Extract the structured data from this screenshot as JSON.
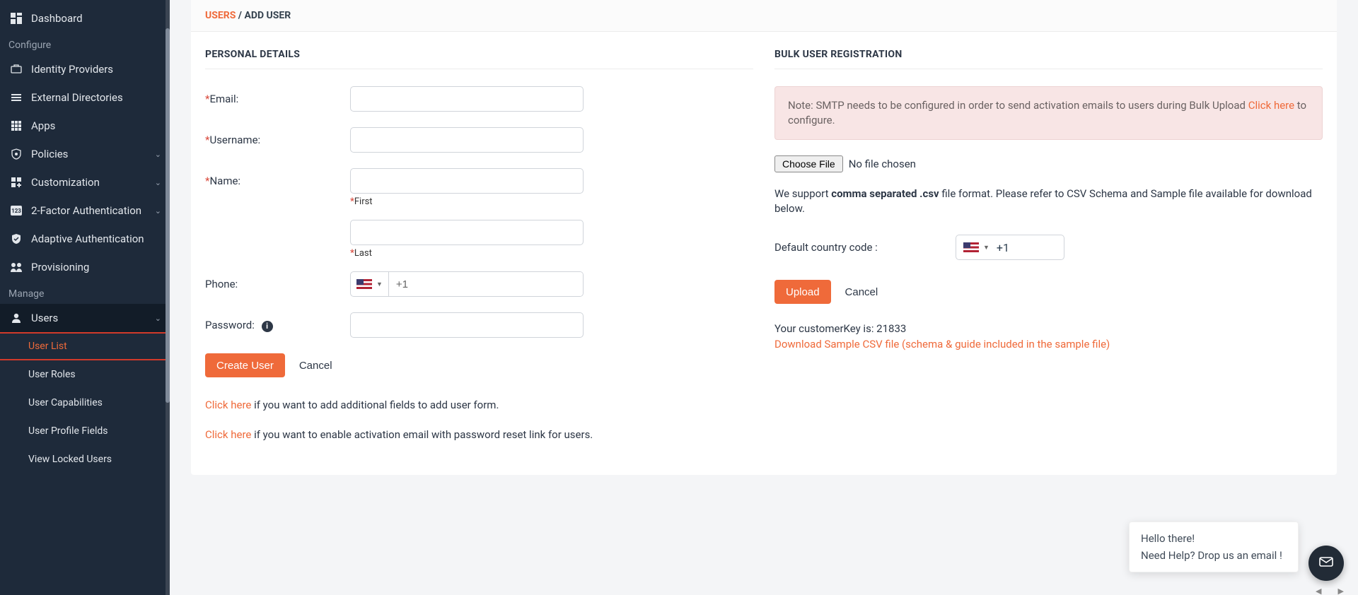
{
  "sidebar": {
    "items": [
      {
        "label": "Dashboard",
        "icon": "dashboard-icon"
      }
    ],
    "section_configure": "Configure",
    "configure_items": [
      {
        "label": "Identity Providers",
        "icon": "idp-icon",
        "chev": false
      },
      {
        "label": "External Directories",
        "icon": "ext-dir-icon",
        "chev": false
      },
      {
        "label": "Apps",
        "icon": "apps-icon",
        "chev": false
      },
      {
        "label": "Policies",
        "icon": "policies-icon",
        "chev": true
      },
      {
        "label": "Customization",
        "icon": "customize-icon",
        "chev": true
      },
      {
        "label": "2-Factor Authentication",
        "icon": "twofa-icon",
        "chev": true
      },
      {
        "label": "Adaptive Authentication",
        "icon": "adaptive-icon",
        "chev": false
      },
      {
        "label": "Provisioning",
        "icon": "provisioning-icon",
        "chev": false
      }
    ],
    "section_manage": "Manage",
    "manage_users": {
      "label": "Users",
      "icon": "users-icon",
      "chev": true
    },
    "sub_items": [
      "User List",
      "User Roles",
      "User Capabilities",
      "User Profile Fields",
      "View Locked Users"
    ]
  },
  "breadcrumb": {
    "link": "USERS",
    "sep": " / ",
    "current": "ADD USER"
  },
  "personal": {
    "title": "PERSONAL DETAILS",
    "email_label": "Email:",
    "username_label": "Username:",
    "name_label": "Name:",
    "first_label": "First",
    "last_label": "Last",
    "phone_label": "Phone:",
    "phone_value": "+1",
    "password_label": "Password:",
    "create_btn": "Create User",
    "cancel_btn": "Cancel",
    "note1_link": "Click here",
    "note1_rest": " if you want to add additional fields to add user form.",
    "note2_link": "Click here",
    "note2_rest": " if you want to enable activation email with password reset link for users."
  },
  "bulk": {
    "title": "BULK USER REGISTRATION",
    "alert_prefix": "Note: SMTP needs to be configured in order to send activation emails to users during Bulk Upload ",
    "alert_link": "Click here",
    "alert_suffix": " to configure.",
    "choose_file": "Choose File",
    "file_status": "No file chosen",
    "support_prefix": "We support ",
    "support_bold": "comma separated .csv",
    "support_suffix": " file format. Please refer to CSV Schema and Sample file available for download below.",
    "country_label": "Default country code :",
    "country_value": "+1",
    "upload_btn": "Upload",
    "cancel_btn": "Cancel",
    "key_prefix": "Your customerKey is: ",
    "key_value": "21833",
    "download_link": "Download Sample CSV file (schema & guide included in the sample file)"
  },
  "chat": {
    "line1": "Hello there!",
    "line2": "Need Help? Drop us an email !"
  }
}
